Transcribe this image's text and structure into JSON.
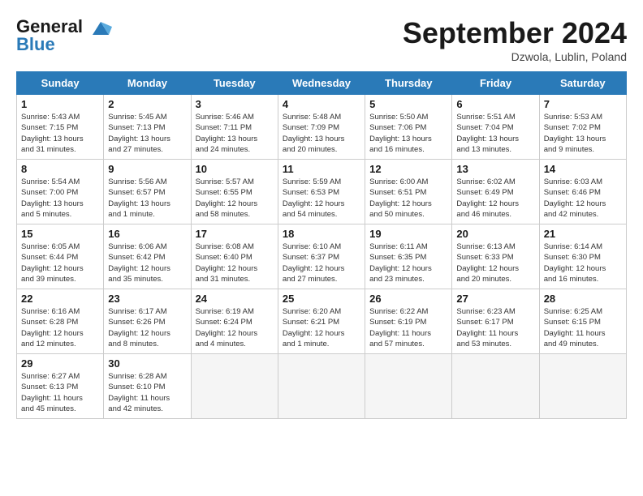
{
  "header": {
    "logo_line1": "General",
    "logo_line2": "Blue",
    "month": "September 2024",
    "location": "Dzwola, Lublin, Poland"
  },
  "weekdays": [
    "Sunday",
    "Monday",
    "Tuesday",
    "Wednesday",
    "Thursday",
    "Friday",
    "Saturday"
  ],
  "weeks": [
    [
      {
        "day": "1",
        "info": "Sunrise: 5:43 AM\nSunset: 7:15 PM\nDaylight: 13 hours\nand 31 minutes."
      },
      {
        "day": "2",
        "info": "Sunrise: 5:45 AM\nSunset: 7:13 PM\nDaylight: 13 hours\nand 27 minutes."
      },
      {
        "day": "3",
        "info": "Sunrise: 5:46 AM\nSunset: 7:11 PM\nDaylight: 13 hours\nand 24 minutes."
      },
      {
        "day": "4",
        "info": "Sunrise: 5:48 AM\nSunset: 7:09 PM\nDaylight: 13 hours\nand 20 minutes."
      },
      {
        "day": "5",
        "info": "Sunrise: 5:50 AM\nSunset: 7:06 PM\nDaylight: 13 hours\nand 16 minutes."
      },
      {
        "day": "6",
        "info": "Sunrise: 5:51 AM\nSunset: 7:04 PM\nDaylight: 13 hours\nand 13 minutes."
      },
      {
        "day": "7",
        "info": "Sunrise: 5:53 AM\nSunset: 7:02 PM\nDaylight: 13 hours\nand 9 minutes."
      }
    ],
    [
      {
        "day": "8",
        "info": "Sunrise: 5:54 AM\nSunset: 7:00 PM\nDaylight: 13 hours\nand 5 minutes."
      },
      {
        "day": "9",
        "info": "Sunrise: 5:56 AM\nSunset: 6:57 PM\nDaylight: 13 hours\nand 1 minute."
      },
      {
        "day": "10",
        "info": "Sunrise: 5:57 AM\nSunset: 6:55 PM\nDaylight: 12 hours\nand 58 minutes."
      },
      {
        "day": "11",
        "info": "Sunrise: 5:59 AM\nSunset: 6:53 PM\nDaylight: 12 hours\nand 54 minutes."
      },
      {
        "day": "12",
        "info": "Sunrise: 6:00 AM\nSunset: 6:51 PM\nDaylight: 12 hours\nand 50 minutes."
      },
      {
        "day": "13",
        "info": "Sunrise: 6:02 AM\nSunset: 6:49 PM\nDaylight: 12 hours\nand 46 minutes."
      },
      {
        "day": "14",
        "info": "Sunrise: 6:03 AM\nSunset: 6:46 PM\nDaylight: 12 hours\nand 42 minutes."
      }
    ],
    [
      {
        "day": "15",
        "info": "Sunrise: 6:05 AM\nSunset: 6:44 PM\nDaylight: 12 hours\nand 39 minutes."
      },
      {
        "day": "16",
        "info": "Sunrise: 6:06 AM\nSunset: 6:42 PM\nDaylight: 12 hours\nand 35 minutes."
      },
      {
        "day": "17",
        "info": "Sunrise: 6:08 AM\nSunset: 6:40 PM\nDaylight: 12 hours\nand 31 minutes."
      },
      {
        "day": "18",
        "info": "Sunrise: 6:10 AM\nSunset: 6:37 PM\nDaylight: 12 hours\nand 27 minutes."
      },
      {
        "day": "19",
        "info": "Sunrise: 6:11 AM\nSunset: 6:35 PM\nDaylight: 12 hours\nand 23 minutes."
      },
      {
        "day": "20",
        "info": "Sunrise: 6:13 AM\nSunset: 6:33 PM\nDaylight: 12 hours\nand 20 minutes."
      },
      {
        "day": "21",
        "info": "Sunrise: 6:14 AM\nSunset: 6:30 PM\nDaylight: 12 hours\nand 16 minutes."
      }
    ],
    [
      {
        "day": "22",
        "info": "Sunrise: 6:16 AM\nSunset: 6:28 PM\nDaylight: 12 hours\nand 12 minutes."
      },
      {
        "day": "23",
        "info": "Sunrise: 6:17 AM\nSunset: 6:26 PM\nDaylight: 12 hours\nand 8 minutes."
      },
      {
        "day": "24",
        "info": "Sunrise: 6:19 AM\nSunset: 6:24 PM\nDaylight: 12 hours\nand 4 minutes."
      },
      {
        "day": "25",
        "info": "Sunrise: 6:20 AM\nSunset: 6:21 PM\nDaylight: 12 hours\nand 1 minute."
      },
      {
        "day": "26",
        "info": "Sunrise: 6:22 AM\nSunset: 6:19 PM\nDaylight: 11 hours\nand 57 minutes."
      },
      {
        "day": "27",
        "info": "Sunrise: 6:23 AM\nSunset: 6:17 PM\nDaylight: 11 hours\nand 53 minutes."
      },
      {
        "day": "28",
        "info": "Sunrise: 6:25 AM\nSunset: 6:15 PM\nDaylight: 11 hours\nand 49 minutes."
      }
    ],
    [
      {
        "day": "29",
        "info": "Sunrise: 6:27 AM\nSunset: 6:13 PM\nDaylight: 11 hours\nand 45 minutes."
      },
      {
        "day": "30",
        "info": "Sunrise: 6:28 AM\nSunset: 6:10 PM\nDaylight: 11 hours\nand 42 minutes."
      },
      {
        "day": "",
        "info": ""
      },
      {
        "day": "",
        "info": ""
      },
      {
        "day": "",
        "info": ""
      },
      {
        "day": "",
        "info": ""
      },
      {
        "day": "",
        "info": ""
      }
    ]
  ]
}
